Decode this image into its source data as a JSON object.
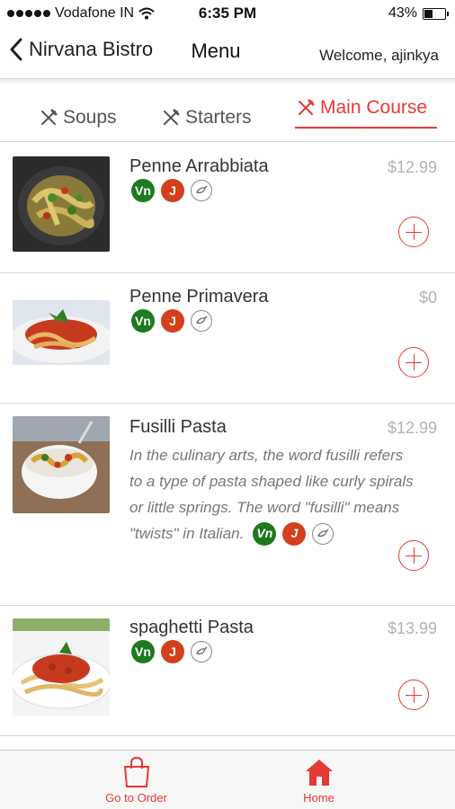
{
  "status_bar": {
    "carrier": "Vodafone IN",
    "time": "6:35 PM",
    "battery": "43%",
    "battery_level": 0.43
  },
  "nav": {
    "back_label": "Nirvana Bistro",
    "title": "Menu",
    "welcome": "Welcome, ajinkya"
  },
  "tabs": [
    {
      "label": "Soups",
      "icon": "utensils-icon",
      "active": false
    },
    {
      "label": "Starters",
      "icon": "utensils-icon",
      "active": false
    },
    {
      "label": "Main Course",
      "icon": "utensils-icon",
      "active": true
    }
  ],
  "items": [
    {
      "name": "Penne Arrabbiata",
      "price": "$12.99",
      "badges": [
        "Vn",
        "J"
      ],
      "description": ""
    },
    {
      "name": "Penne Primavera",
      "price": "$0",
      "badges": [
        "Vn",
        "J"
      ],
      "description": ""
    },
    {
      "name": "Fusilli Pasta",
      "price": "$12.99",
      "badges": [
        "Vn",
        "J"
      ],
      "description_lines": [
        "In the culinary arts, the word fusilli refers",
        "to a type of pasta shaped like curly spirals",
        "or little springs. The word \"fusilli\" means",
        "\"twists\" in Italian."
      ]
    },
    {
      "name": "spaghetti Pasta",
      "price": "$13.99",
      "badges": [
        "Vn",
        "J"
      ],
      "description": ""
    }
  ],
  "bottom_tabs": [
    {
      "label": "Go to Order",
      "icon": "shopping-bag-icon"
    },
    {
      "label": "Home",
      "icon": "home-icon"
    }
  ],
  "colors": {
    "accent": "#e53935",
    "veg_badge": "#1f7a1f",
    "jain_badge": "#d2401c",
    "price": "#b3b3b3"
  }
}
